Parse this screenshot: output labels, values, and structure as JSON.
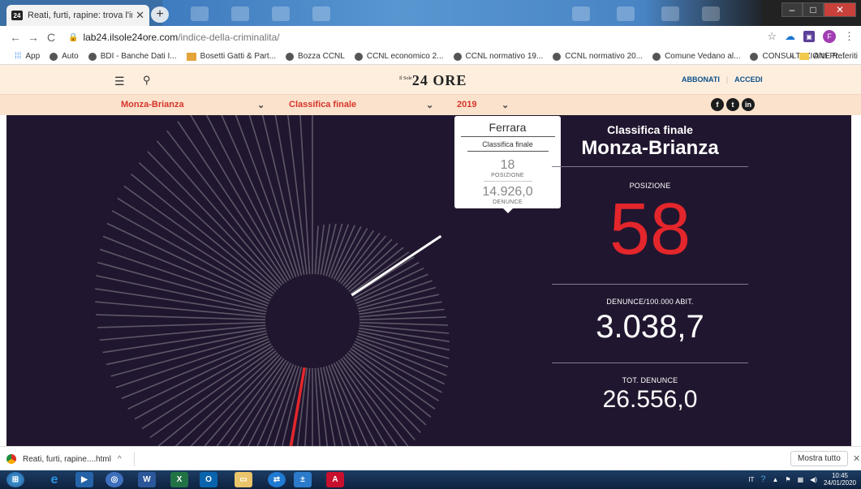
{
  "browser": {
    "tab_title": "Reati, furti, rapine: trova l'indice d",
    "tab_icon": "24",
    "url_host": "lab24.ilsole24ore.com",
    "url_path": "/indice-della-criminalita/",
    "profile_initial": "F",
    "bookmarks": [
      "App",
      "Auto",
      "BDI - Banche Dati I...",
      "Bosetti Gatti & Part...",
      "Bozza CCNL",
      "CCNL economico 2...",
      "CCNL normativo 19...",
      "CCNL normativo 20...",
      "Comune Vedano al...",
      "CONSULTAZIONE R..."
    ],
    "other_bookmarks": "Altri Preferiti"
  },
  "site": {
    "logo_small": "Il Sole",
    "logo": "24 ORE",
    "subscribe": "ABBONATI",
    "login": "ACCEDI"
  },
  "filters": {
    "province": "Monza-Brianza",
    "ranking": "Classifica finale",
    "year": "2019"
  },
  "tooltip": {
    "city": "Ferrara",
    "metric": "Classifica finale",
    "position": "18",
    "position_label": "POSIZIONE",
    "value": "14.926,0",
    "value_label": "DENUNCE"
  },
  "panel": {
    "heading": "Classifica finale",
    "province": "Monza-Brianza",
    "position_label": "POSIZIONE",
    "position": "58",
    "rate_label": "DENUNCE/100.000 ABIT.",
    "rate": "3.038,7",
    "total_label": "TOT. DENUNCE",
    "total": "26.556,0"
  },
  "download_bar": {
    "file": "Reati, furti, rapine....html",
    "show_all": "Mostra tutto"
  },
  "taskbar": {
    "lang": "IT",
    "time": "10:45",
    "date": "24/01/2020"
  },
  "colors": {
    "background": "#21162f",
    "bars": "#5d5868",
    "highlight": "#ffffff",
    "selected": "#e3262b",
    "accent": "#d6362c"
  }
}
